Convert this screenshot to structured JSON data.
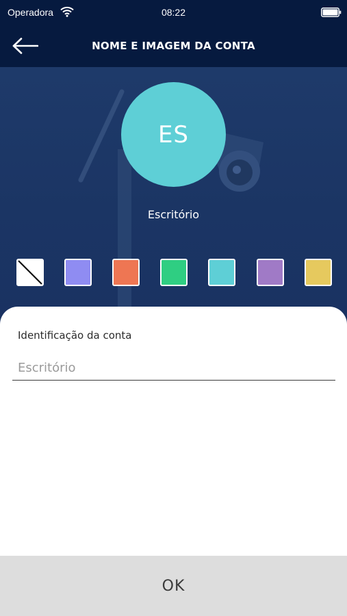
{
  "status_bar": {
    "carrier": "Operadora",
    "time": "08:22",
    "icons": [
      "wifi-icon",
      "battery-icon"
    ]
  },
  "nav": {
    "title": "NOME E IMAGEM DA CONTA",
    "back_icon": "arrow-left-icon"
  },
  "account": {
    "initials": "ES",
    "name": "Escritório",
    "avatar_color": "#5ecfd6"
  },
  "color_swatches": [
    {
      "name": "none",
      "color": "#ffffff"
    },
    {
      "name": "periwinkle",
      "color": "#8f8cf2"
    },
    {
      "name": "orange",
      "color": "#ee7653"
    },
    {
      "name": "green",
      "color": "#2fce82"
    },
    {
      "name": "cyan",
      "color": "#5ecfd6"
    },
    {
      "name": "purple",
      "color": "#a07ac6"
    },
    {
      "name": "yellow",
      "color": "#e6c95e"
    }
  ],
  "form": {
    "label": "Identificação da conta",
    "placeholder": "Escritório",
    "value": ""
  },
  "ok_button": {
    "label": "OK"
  },
  "colors": {
    "header_bg": "#061a3f",
    "hero_bg": "#1d3765",
    "ok_bg": "#dddddd"
  }
}
